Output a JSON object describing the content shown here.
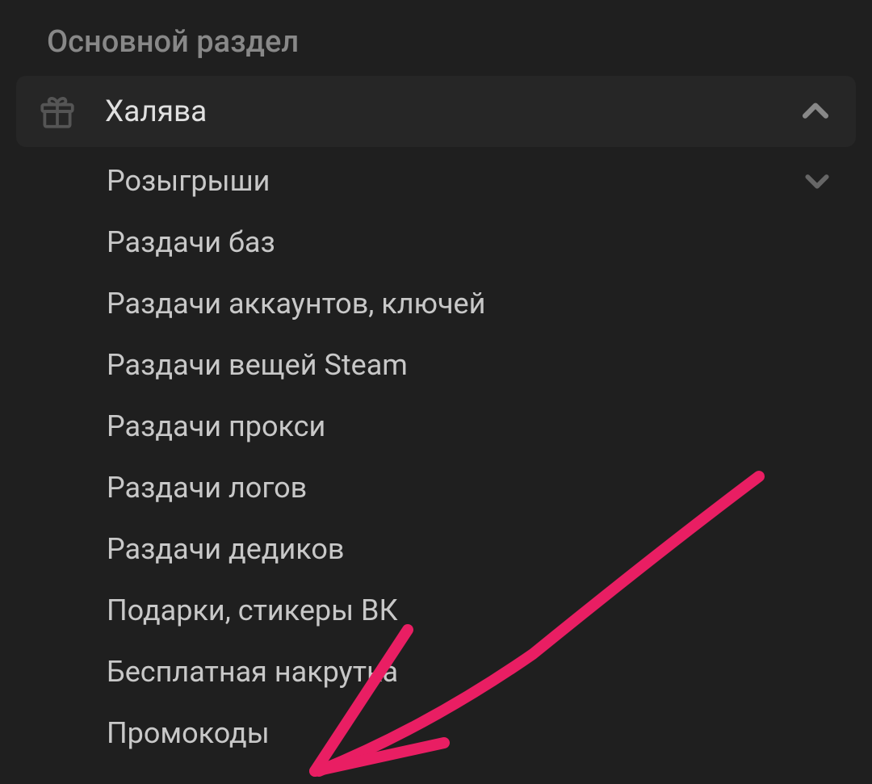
{
  "section": {
    "title": "Основной раздел"
  },
  "main_item": {
    "icon": "gift-icon",
    "label": "Халява",
    "expanded": true
  },
  "sub_items": [
    {
      "label": "Розыгрыши",
      "expandable": true
    },
    {
      "label": "Раздачи баз",
      "expandable": false
    },
    {
      "label": "Раздачи аккаунтов, ключей",
      "expandable": false
    },
    {
      "label": "Раздачи вещей Steam",
      "expandable": false
    },
    {
      "label": "Раздачи прокси",
      "expandable": false
    },
    {
      "label": "Раздачи логов",
      "expandable": false
    },
    {
      "label": "Раздачи дедиков",
      "expandable": false
    },
    {
      "label": "Подарки, стикеры ВК",
      "expandable": false
    },
    {
      "label": "Бесплатная накрутка",
      "expandable": false
    },
    {
      "label": "Промокоды",
      "expandable": false
    }
  ],
  "annotation": {
    "color": "#e91e63",
    "target_label": "Промокоды"
  }
}
